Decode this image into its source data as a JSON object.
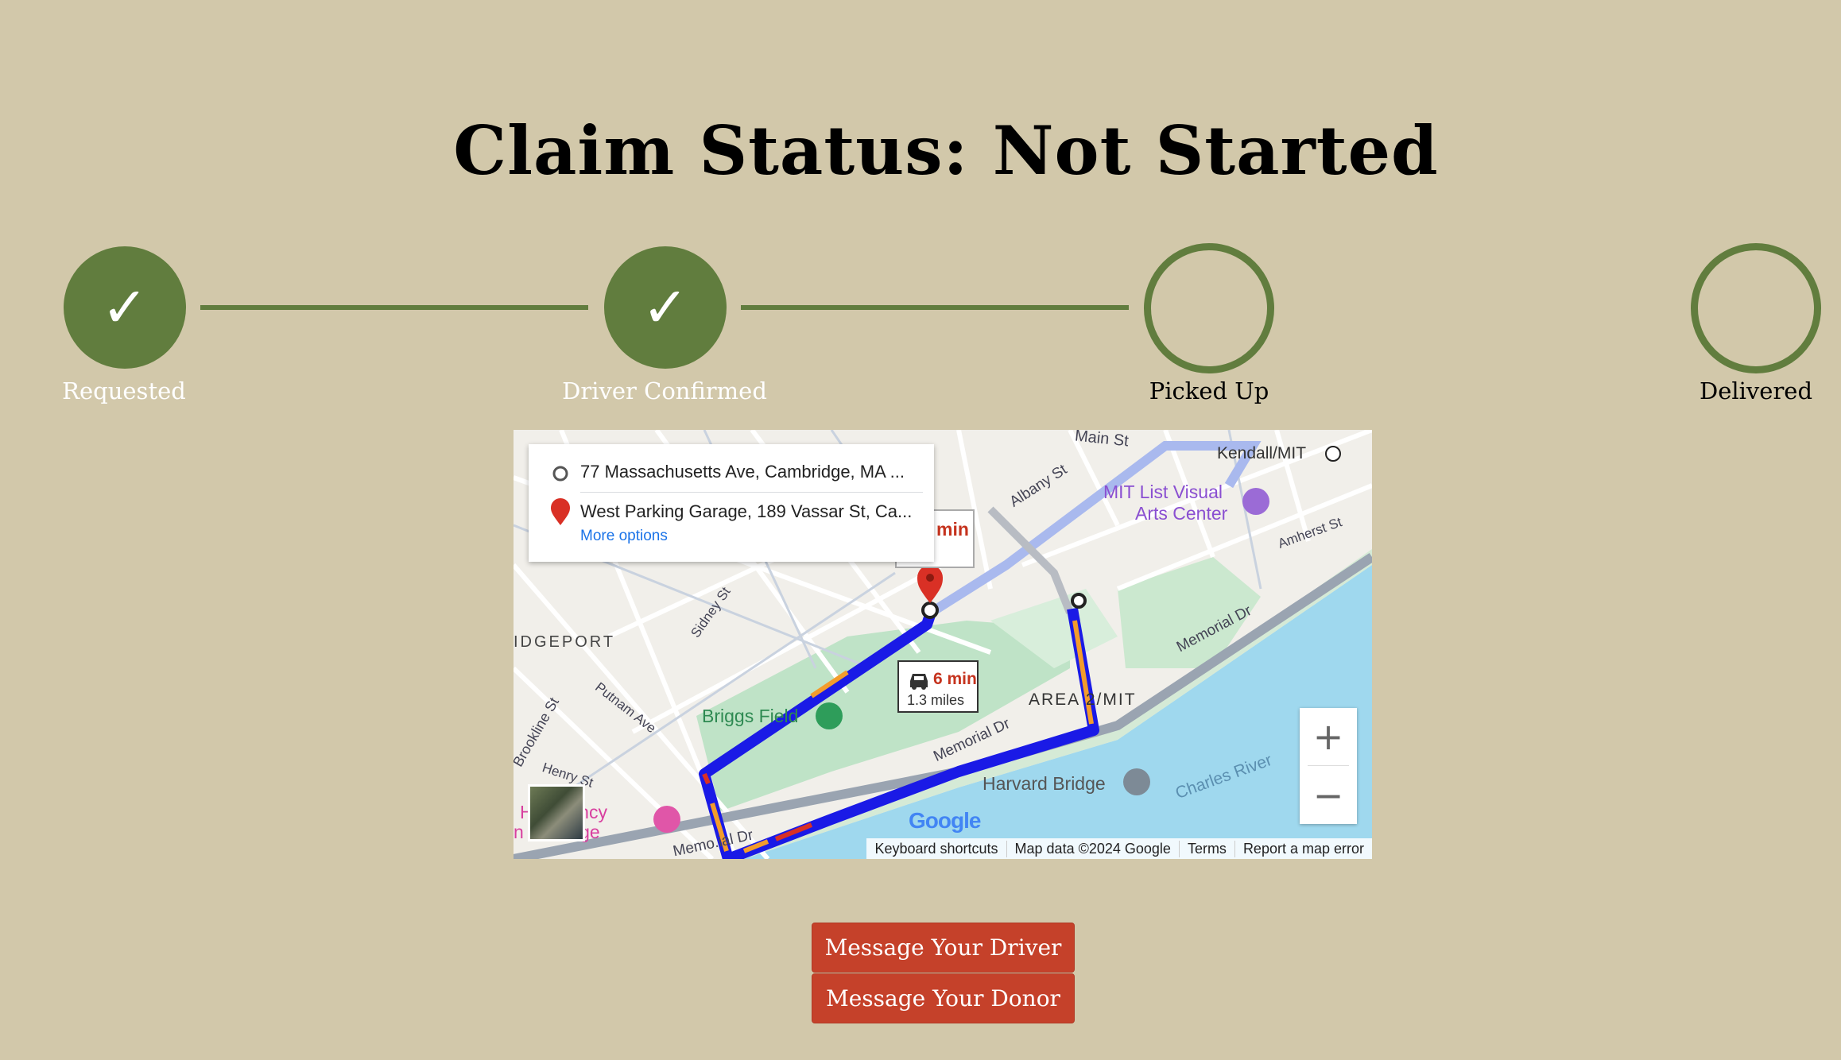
{
  "page": {
    "title": "Claim Status: Not Started"
  },
  "progress": {
    "steps": [
      {
        "label": "Requested",
        "done": true,
        "check": "✓"
      },
      {
        "label": "Driver Confirmed",
        "done": true,
        "check": "✓"
      },
      {
        "label": "Picked Up",
        "done": false
      },
      {
        "label": "Delivered",
        "done": false
      }
    ]
  },
  "map": {
    "origin": "77 Massachusetts Ave, Cambridge, MA ...",
    "destination": "West Parking Garage, 189 Vassar St, Ca...",
    "more_options": "More options",
    "route_time": "6 min",
    "route_distance": "1.3 miles",
    "alt_route_time": "min",
    "zoom_in": "+",
    "zoom_out": "−",
    "google_logo": "Google",
    "attribution": {
      "shortcuts": "Keyboard shortcuts",
      "map_data": "Map data ©2024 Google",
      "terms": "Terms",
      "report": "Report a map error"
    },
    "labels": {
      "main_st": "Main St",
      "kendall": "Kendall/MIT",
      "albany": "Albany St",
      "mit_list_1": "MIT List Visual",
      "mit_list_2": "Arts Center",
      "amherst": "Amherst St",
      "memorial_dr_1": "Memorial Dr",
      "memorial_dr_2": "Memorial Dr",
      "memorial_dr_3": "Memo.ial Dr",
      "bridgeport": "IDGEPORT",
      "sidney": "Sidney St",
      "putnam": "Putnam Ave",
      "briggs": "Briggs Field",
      "area2": "AREA 2/MIT",
      "harvard_bridge": "Harvard Bridge",
      "charles": "Charles River",
      "brookline": "Brookline St",
      "henry": "Henry St",
      "hyatt_1": "H   egency",
      "hyatt_2": "n   ubridge"
    }
  },
  "buttons": {
    "message_driver": "Message Your Driver",
    "message_donor": "Message Your Donor"
  },
  "colors": {
    "background": "#d2c8aa",
    "accent_green": "#617d3e",
    "button_red": "#c5412a",
    "route_blue": "#1a1ae6",
    "route_orange": "#f39c2c"
  },
  "icons": {
    "origin": "origin-circle-icon",
    "destination": "map-pin-icon",
    "car": "car-icon",
    "transit": "transit-icon",
    "museum": "museum-icon",
    "sports": "sports-icon",
    "hotel": "hotel-icon",
    "bridge": "bridge-icon"
  }
}
